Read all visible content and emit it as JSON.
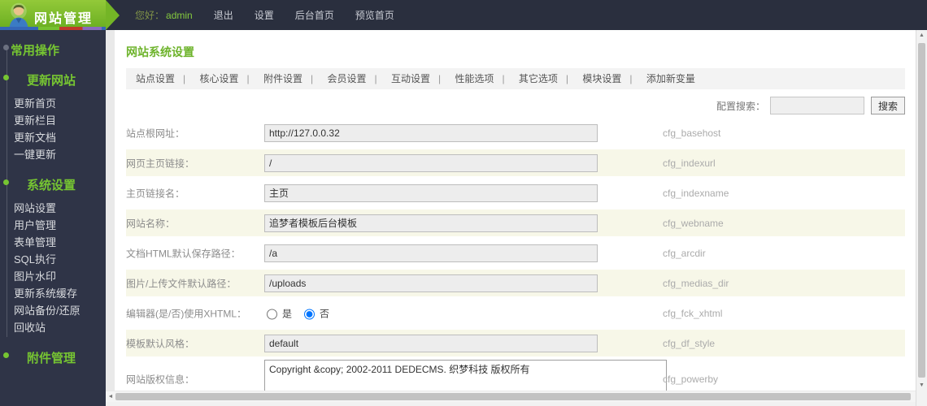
{
  "colors": {
    "accent_green": "#76c12f",
    "topbar_bg": "#2a2f3e",
    "sidebar_bg": "#2f3447",
    "alt_row_bg": "#f7f7e8",
    "title_green": "#6db32b"
  },
  "topbar": {
    "logo_title": "网站管理",
    "greeting": "您好：",
    "username": "admin",
    "menu": [
      {
        "label": "退出"
      },
      {
        "label": "设置"
      },
      {
        "label": "后台首页"
      },
      {
        "label": "预览首页"
      }
    ]
  },
  "sidebar": {
    "title": "常用操作",
    "groups": [
      {
        "header": "更新网站",
        "items": [
          "更新首页",
          "更新栏目",
          "更新文档",
          "一键更新"
        ]
      },
      {
        "header": "系统设置",
        "items": [
          "网站设置",
          "用户管理",
          "表单管理",
          "SQL执行",
          "图片水印",
          "更新系统缓存",
          "网站备份/还原",
          "回收站"
        ]
      },
      {
        "header": "附件管理",
        "items": []
      }
    ]
  },
  "main": {
    "page_title": "网站系统设置",
    "tabs": [
      {
        "label": "站点设置"
      },
      {
        "label": "核心设置"
      },
      {
        "label": "附件设置"
      },
      {
        "label": "会员设置"
      },
      {
        "label": "互动设置"
      },
      {
        "label": "性能选项"
      },
      {
        "label": "其它选项"
      },
      {
        "label": "模块设置"
      },
      {
        "label": "添加新变量"
      }
    ],
    "search": {
      "label": "配置搜索：",
      "value": "",
      "button": "搜索"
    },
    "form": {
      "rows": [
        {
          "label": "站点根网址：",
          "value": "http://127.0.0.32",
          "var": "cfg_basehost"
        },
        {
          "label": "网页主页链接：",
          "value": "/",
          "var": "cfg_indexurl"
        },
        {
          "label": "主页链接名：",
          "value": "主页",
          "var": "cfg_indexname"
        },
        {
          "label": "网站名称：",
          "value": "追梦者模板后台模板",
          "var": "cfg_webname"
        },
        {
          "label": "文档HTML默认保存路径：",
          "value": "/a",
          "var": "cfg_arcdir"
        },
        {
          "label": "图片/上传文件默认路径：",
          "value": "/uploads",
          "var": "cfg_medias_dir"
        },
        {
          "label": "编辑器(是/否)使用XHTML：",
          "var": "cfg_fck_xhtml",
          "options": [
            {
              "label": "是",
              "checked": false
            },
            {
              "label": "否",
              "checked": true
            }
          ]
        },
        {
          "label": "模板默认风格：",
          "value": "default",
          "var": "cfg_df_style"
        },
        {
          "label": "网站版权信息：",
          "value": "Copyright &copy; 2002-2011 DEDECMS. 织梦科技 版权所有",
          "var": "cfg_powerby"
        }
      ]
    }
  }
}
